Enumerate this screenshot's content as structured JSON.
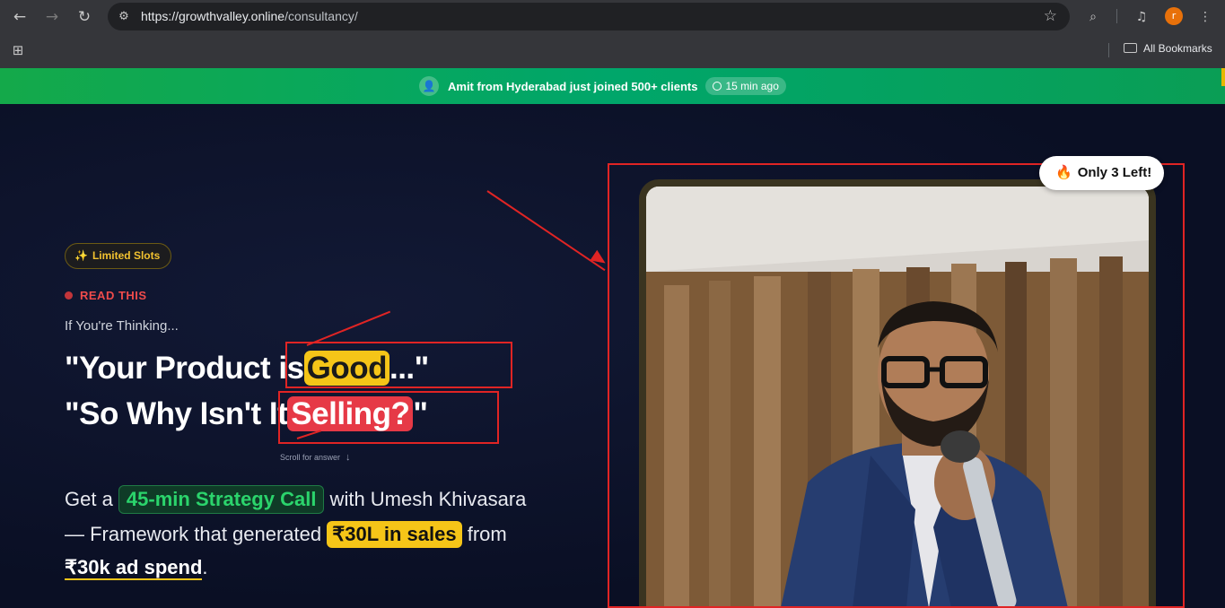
{
  "browser": {
    "url_domain": "https://growthvalley.online",
    "url_path": "/consultancy/",
    "profile_initial": "r",
    "bookmarks_label": "All Bookmarks"
  },
  "notification": {
    "name": "Amit",
    "text": " from Hyderabad just joined 500+ clients",
    "time": "15 min ago",
    "color": "#14a94a"
  },
  "hero": {
    "badge": "Limited Slots",
    "eyebrow": "READ THIS",
    "intro": "If You're Thinking...",
    "line1_pre": "\"Your Product is",
    "line1_hl": "Good",
    "line1_post": "...\"",
    "line2_pre": "\"So Why Isn't It",
    "line2_hl": "Selling?",
    "line2_post": "\"",
    "scroll_hint": "Scroll for answer",
    "offer_pre": "Get a ",
    "offer_pill": "45-min Strategy Call",
    "offer_mid": " with Umesh Khivasara",
    "offer_line2_pre": "— Framework that generated ",
    "offer_line2_pill": "₹30L in sales",
    "offer_line2_post": " from",
    "offer_line3_ul": "₹30k ad spend",
    "offer_line3_post": ".",
    "scarcity": "Only 3 Left!"
  },
  "colors": {
    "annotation_red": "#e02424",
    "highlight_yellow": "#f5c518",
    "highlight_red": "#e63946",
    "accent_green": "#2bd46c"
  }
}
